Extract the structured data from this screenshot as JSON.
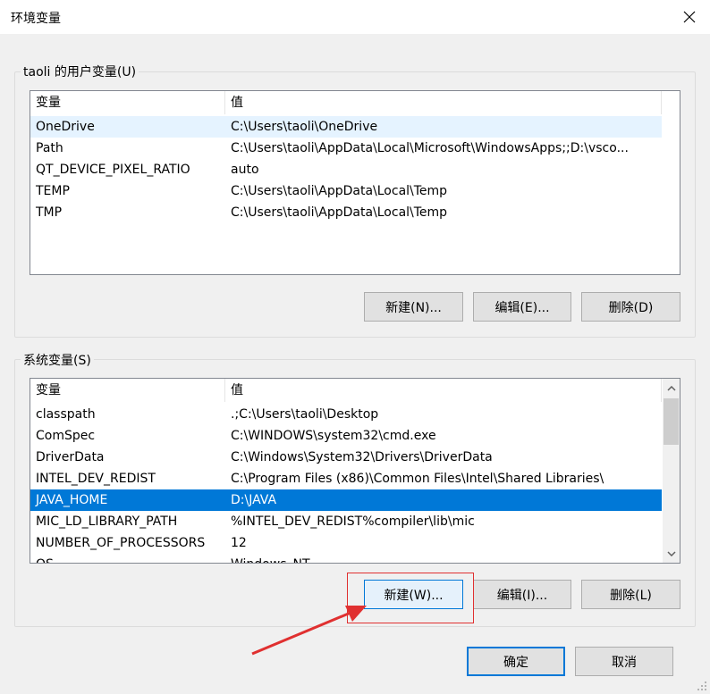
{
  "window": {
    "title": "环境变量",
    "close_icon": "close-icon"
  },
  "user_vars": {
    "group_label": "taoli 的用户变量(U)",
    "columns": [
      "变量",
      "值"
    ],
    "rows": [
      {
        "name": "OneDrive",
        "value": "C:\\Users\\taoli\\OneDrive"
      },
      {
        "name": "Path",
        "value": "C:\\Users\\taoli\\AppData\\Local\\Microsoft\\WindowsApps;;D:\\vsco..."
      },
      {
        "name": "QT_DEVICE_PIXEL_RATIO",
        "value": "auto"
      },
      {
        "name": "TEMP",
        "value": "C:\\Users\\taoli\\AppData\\Local\\Temp"
      },
      {
        "name": "TMP",
        "value": "C:\\Users\\taoli\\AppData\\Local\\Temp"
      }
    ],
    "buttons": {
      "new": "新建(N)...",
      "edit": "编辑(E)...",
      "delete": "删除(D)"
    }
  },
  "system_vars": {
    "group_label": "系统变量(S)",
    "columns": [
      "变量",
      "值"
    ],
    "rows": [
      {
        "name": "classpath",
        "value": ".;C:\\Users\\taoli\\Desktop"
      },
      {
        "name": "ComSpec",
        "value": "C:\\WINDOWS\\system32\\cmd.exe"
      },
      {
        "name": "DriverData",
        "value": "C:\\Windows\\System32\\Drivers\\DriverData"
      },
      {
        "name": "INTEL_DEV_REDIST",
        "value": "C:\\Program Files (x86)\\Common Files\\Intel\\Shared Libraries\\"
      },
      {
        "name": "JAVA_HOME",
        "value": "D:\\JAVA"
      },
      {
        "name": "MIC_LD_LIBRARY_PATH",
        "value": "%INTEL_DEV_REDIST%compiler\\lib\\mic"
      },
      {
        "name": "NUMBER_OF_PROCESSORS",
        "value": "12"
      },
      {
        "name": "OS",
        "value": "Windows_NT"
      }
    ],
    "selected_row": "JAVA_HOME",
    "buttons": {
      "new": "新建(W)...",
      "edit": "编辑(I)...",
      "delete": "删除(L)"
    }
  },
  "footer": {
    "ok": "确定",
    "cancel": "取消"
  },
  "colors": {
    "selection": "#0078d7",
    "annotation": "#e03030"
  }
}
